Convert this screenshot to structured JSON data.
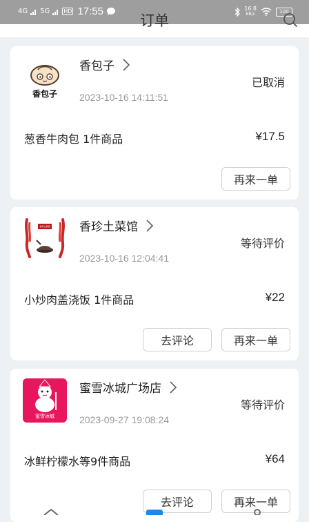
{
  "statusbar": {
    "network1": "4G",
    "network2": "5G",
    "hd": "HD",
    "time": "17:55",
    "speed_value": "16.8",
    "speed_unit": "KB/s",
    "battery": "100"
  },
  "header": {
    "title": "订单"
  },
  "orders": [
    {
      "shop": "香包子",
      "logo_text": "香包子",
      "status": "已取消",
      "time": "2023-10-16 14:11:51",
      "item": "葱香牛肉包 1件商品",
      "price": "¥17.5",
      "review_label": "",
      "again_label": "再来一单"
    },
    {
      "shop": "香珍土菜馆",
      "logo_text": "香珍土菜馆",
      "status": "等待评价",
      "time": "2023-10-16 12:04:41",
      "item": "小炒肉盖浇饭 1件商品",
      "price": "¥22",
      "review_label": "去评论",
      "again_label": "再来一单"
    },
    {
      "shop": "蜜雪冰城广场店",
      "logo_text": "蜜雪冰城",
      "status": "等待评价",
      "time": "2023-09-27 19:08:24",
      "item": "冰鲜柠檬水等9件商品",
      "price": "¥64",
      "review_label": "去评论",
      "again_label": "再来一单"
    }
  ],
  "colors": {
    "accent": "#1e88e5",
    "brand_red": "#e8175d"
  }
}
